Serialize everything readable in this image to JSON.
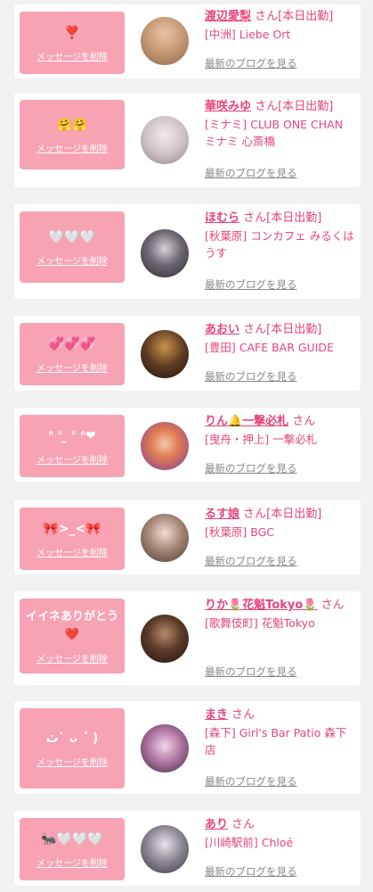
{
  "delete_label": "メッセージを削除",
  "blog_label": "最新のブログを見る",
  "entries": [
    {
      "stamp": "❣️",
      "name": "渡辺愛梨",
      "suffix": "さん[本日出勤]",
      "shop": "[中洲] Liebe Ort"
    },
    {
      "stamp": "🤗🤗",
      "name": "華咲みゆ",
      "suffix": "さん[本日出勤]",
      "shop": "[ミナミ] CLUB ONE CHAN ミナミ 心斎橋"
    },
    {
      "stamp": "🤍🤍🤍",
      "name": "ほむら",
      "suffix": "さん[本日出勤]",
      "shop": "[秋葉原] コンカフェ みるくはうす"
    },
    {
      "stamp": "💞💞💞",
      "name": "あおい",
      "suffix": "さん[本日出勤]",
      "shop": "[豊田] CAFE BAR GUIDE"
    },
    {
      "stamp": "ᐢ ᐡ ̫ ᐡ ᐢ❤︎",
      "name": "りん🔔一撃必札",
      "suffix": "さん",
      "shop": "[曳舟・押上] 一撃必札"
    },
    {
      "stamp": "🎀>_<🎀",
      "name": "るす娘",
      "suffix": "さん[本日出勤]",
      "shop": "[秋葉原] BGC"
    },
    {
      "stamp": "イイネありがとう❤️",
      "name": "りか🌷花魁Tokyo🌷",
      "suffix": "さん",
      "shop": "[歌舞伎町] 花魁Tokyo"
    },
    {
      "stamp": "ﭢ` ᴗ ´ )",
      "name": "まき",
      "suffix": "さん",
      "shop": "[森下] Girl's Bar Patio 森下店"
    },
    {
      "stamp": "🐜🤍🤍🤍",
      "name": "あり",
      "suffix": "さん",
      "shop": "[川崎駅前] Chloé"
    }
  ],
  "colors": {
    "accent": "#e5457a",
    "stamp_bg": "#f7a3b4",
    "page_bg": "#f2f2f2"
  }
}
